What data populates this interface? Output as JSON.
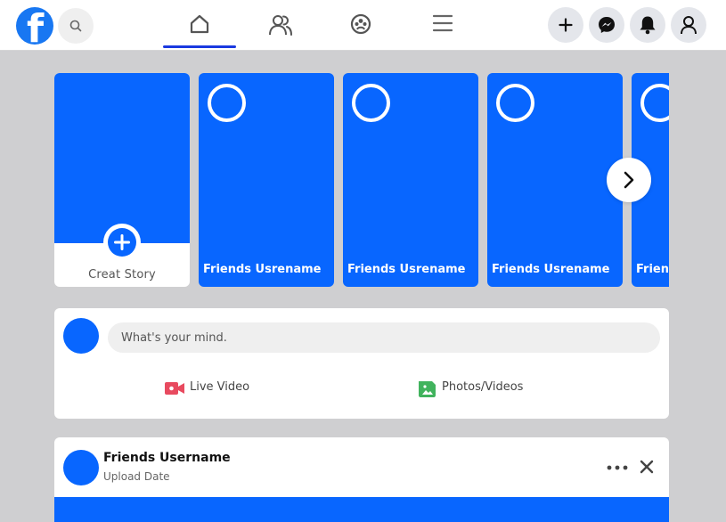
{
  "header": {
    "logo": "facebook-logo",
    "logo_letter": "f",
    "nav": [
      {
        "name": "home",
        "icon": "home-icon",
        "active": true
      },
      {
        "name": "friends",
        "icon": "friends-icon",
        "active": false
      },
      {
        "name": "groups",
        "icon": "groups-icon",
        "active": false
      },
      {
        "name": "menu",
        "icon": "menu-icon",
        "active": false
      }
    ],
    "actions": [
      "plus-icon",
      "messenger-icon",
      "bell-icon",
      "user-icon"
    ]
  },
  "stories": {
    "create_label": "Creat Story",
    "friends": [
      {
        "name": "Friends Usrename"
      },
      {
        "name": "Friends Usrename"
      },
      {
        "name": "Friends Usrename"
      },
      {
        "name": "Friends Usrename"
      }
    ]
  },
  "composer": {
    "placeholder": "What's your mind.",
    "live_video_label": "Live Video",
    "photos_label": "Photos/Videos"
  },
  "post": {
    "username": "Friends Username",
    "date": "Upload Date"
  },
  "colors": {
    "brand": "#0866ff",
    "logo": "#1877f2",
    "active_tab": "#1a39e0",
    "live_video": "#e84a5f",
    "photos": "#41b35d",
    "background": "#cfcfd1"
  }
}
